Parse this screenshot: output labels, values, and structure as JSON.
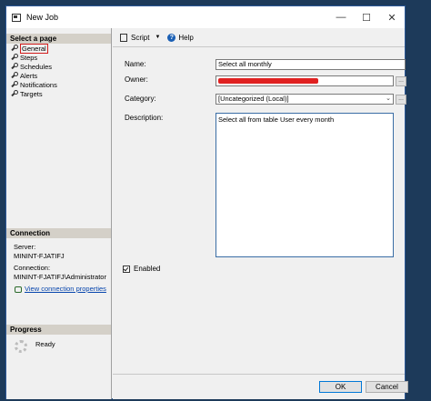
{
  "window": {
    "title": "New Job",
    "icon": "job-window-icon",
    "controls": {
      "minimize": "—",
      "maximize": "☐",
      "close": "✕"
    }
  },
  "left_panel": {
    "select_page_header": "Select a page",
    "pages": [
      {
        "label": "General",
        "selected": true
      },
      {
        "label": "Steps"
      },
      {
        "label": "Schedules"
      },
      {
        "label": "Alerts"
      },
      {
        "label": "Notifications"
      },
      {
        "label": "Targets"
      }
    ],
    "connection_header": "Connection",
    "server_label": "Server:",
    "server_value": "MININT-FJATIFJ",
    "connection_label": "Connection:",
    "connection_value": "MININT-FJATIFJ\\Administrator",
    "view_connection_link": "View connection properties",
    "progress_header": "Progress",
    "progress_status": "Ready"
  },
  "toolbar": {
    "script_label": "Script",
    "help_label": "Help"
  },
  "form": {
    "name_label": "Name:",
    "name_value": "Select all monthly",
    "owner_label": "Owner:",
    "owner_value": "",
    "category_label": "Category:",
    "category_value": "[Uncategorized (Local)]",
    "description_label": "Description:",
    "description_value": "Select all from table User every month",
    "enabled_label": "Enabled",
    "enabled_checked": true,
    "browse_button": "..."
  },
  "footer": {
    "ok_label": "OK",
    "cancel_label": "Cancel"
  },
  "colors": {
    "selection_outline": "#d21c1c",
    "link": "#0645ad",
    "focus_border": "#3a6ea5"
  }
}
